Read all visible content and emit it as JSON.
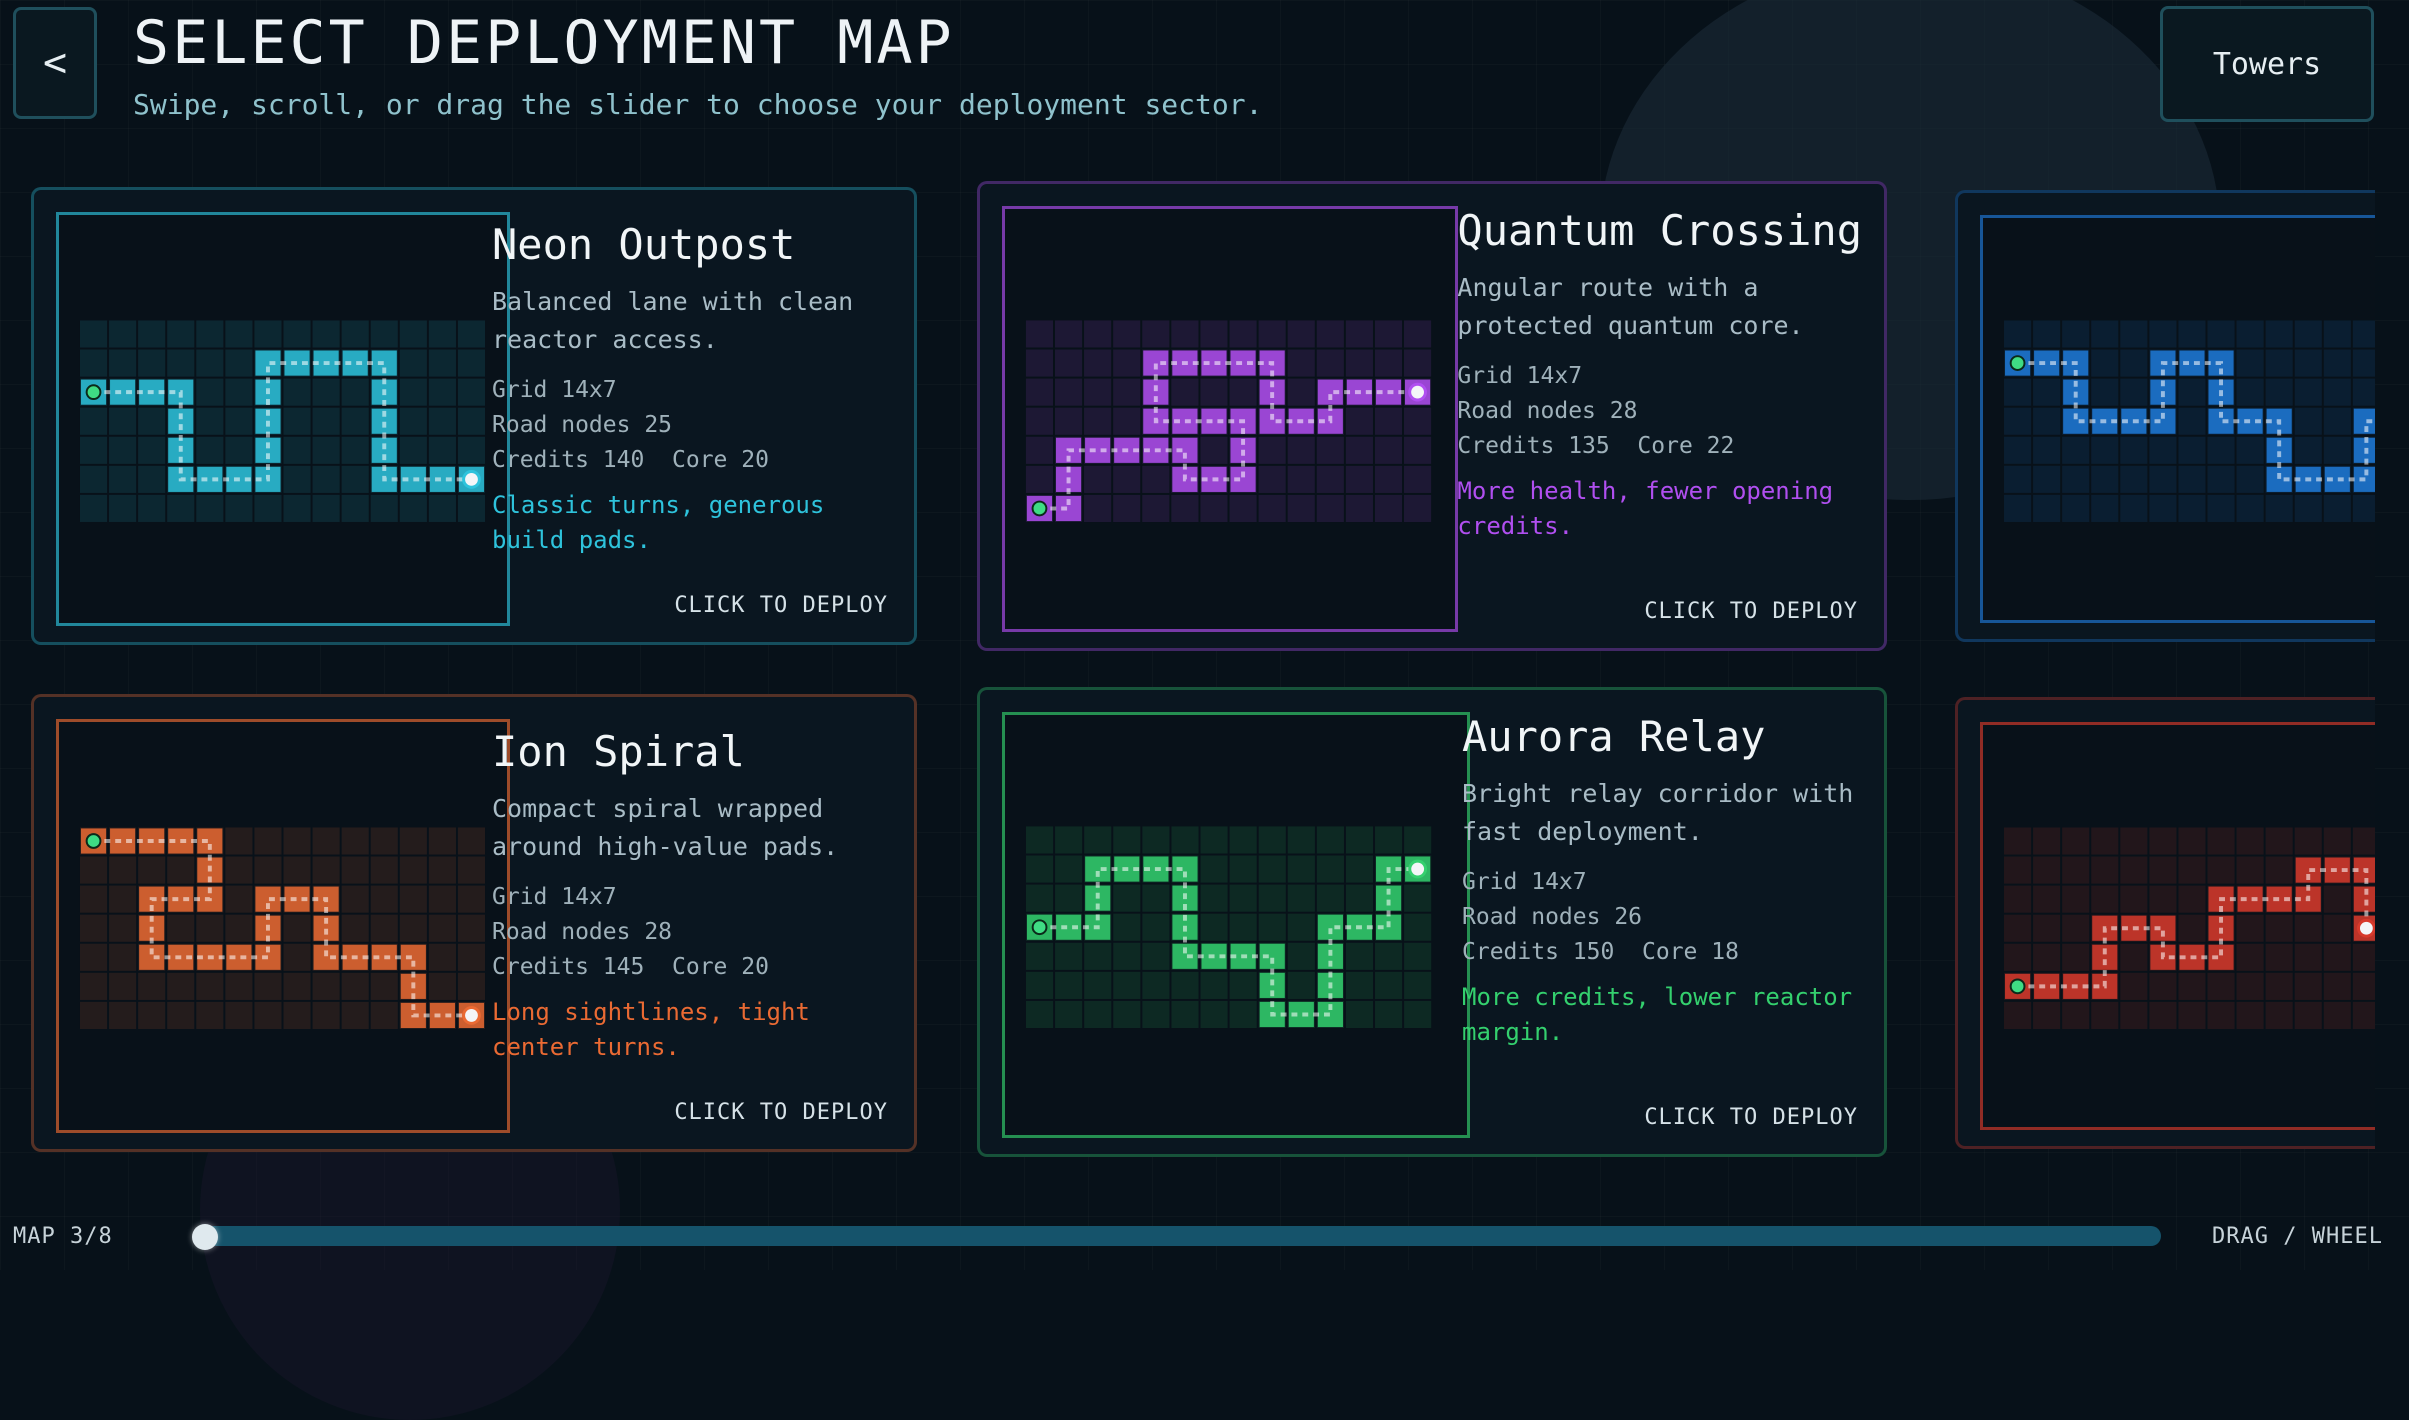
{
  "header": {
    "back_label": "<",
    "title": "SELECT DEPLOYMENT MAP",
    "subtitle": "Swipe, scroll, or drag the slider to choose your deployment sector.",
    "towers_label": "Towers"
  },
  "maps": [
    {
      "name": "Neon Outpost",
      "description": "Balanced lane with clean reactor access.",
      "grid": "Grid 14x7",
      "road_nodes": "Road nodes 25",
      "credits_core": "Credits 140  Core 20",
      "note": "Classic turns, generous build pads.",
      "deploy_label": "CLICK TO DEPLOY",
      "accent": "#2ec3dc",
      "path": [
        [
          0,
          2
        ],
        [
          1,
          2
        ],
        [
          2,
          2
        ],
        [
          3,
          2
        ],
        [
          3,
          3
        ],
        [
          3,
          4
        ],
        [
          3,
          5
        ],
        [
          4,
          5
        ],
        [
          5,
          5
        ],
        [
          6,
          5
        ],
        [
          6,
          4
        ],
        [
          6,
          3
        ],
        [
          6,
          2
        ],
        [
          6,
          1
        ],
        [
          7,
          1
        ],
        [
          8,
          1
        ],
        [
          9,
          1
        ],
        [
          10,
          1
        ],
        [
          10,
          2
        ],
        [
          10,
          3
        ],
        [
          10,
          4
        ],
        [
          10,
          5
        ],
        [
          11,
          5
        ],
        [
          12,
          5
        ],
        [
          13,
          5
        ]
      ]
    },
    {
      "name": "Quantum Crossing",
      "description": "Angular route with a protected quantum core.",
      "grid": "Grid 14x7",
      "road_nodes": "Road nodes 28",
      "credits_core": "Credits 135  Core 22",
      "note": "More health, fewer opening credits.",
      "deploy_label": "CLICK TO DEPLOY",
      "accent": "#b04ff0",
      "path": [
        [
          0,
          6
        ],
        [
          1,
          6
        ],
        [
          1,
          5
        ],
        [
          1,
          4
        ],
        [
          2,
          4
        ],
        [
          3,
          4
        ],
        [
          4,
          4
        ],
        [
          5,
          4
        ],
        [
          5,
          5
        ],
        [
          6,
          5
        ],
        [
          7,
          5
        ],
        [
          7,
          4
        ],
        [
          7,
          3
        ],
        [
          6,
          3
        ],
        [
          5,
          3
        ],
        [
          4,
          3
        ],
        [
          4,
          2
        ],
        [
          4,
          1
        ],
        [
          5,
          1
        ],
        [
          6,
          1
        ],
        [
          7,
          1
        ],
        [
          8,
          1
        ],
        [
          8,
          2
        ],
        [
          8,
          3
        ],
        [
          9,
          3
        ],
        [
          10,
          3
        ],
        [
          10,
          2
        ],
        [
          11,
          2
        ],
        [
          12,
          2
        ],
        [
          13,
          2
        ]
      ]
    },
    {
      "name": "Ion Spiral",
      "description": "Compact spiral wrapped around high-value pads.",
      "grid": "Grid 14x7",
      "road_nodes": "Road nodes 28",
      "credits_core": "Credits 145  Core 20",
      "note": "Long sightlines, tight center turns.",
      "deploy_label": "CLICK TO DEPLOY",
      "accent": "#ea6a33",
      "path": [
        [
          0,
          0
        ],
        [
          1,
          0
        ],
        [
          2,
          0
        ],
        [
          3,
          0
        ],
        [
          4,
          0
        ],
        [
          4,
          1
        ],
        [
          4,
          2
        ],
        [
          3,
          2
        ],
        [
          2,
          2
        ],
        [
          2,
          3
        ],
        [
          2,
          4
        ],
        [
          3,
          4
        ],
        [
          4,
          4
        ],
        [
          5,
          4
        ],
        [
          6,
          4
        ],
        [
          6,
          3
        ],
        [
          6,
          2
        ],
        [
          7,
          2
        ],
        [
          8,
          2
        ],
        [
          8,
          3
        ],
        [
          8,
          4
        ],
        [
          9,
          4
        ],
        [
          10,
          4
        ],
        [
          11,
          4
        ],
        [
          11,
          5
        ],
        [
          11,
          6
        ],
        [
          12,
          6
        ],
        [
          13,
          6
        ]
      ]
    },
    {
      "name": "Aurora Relay",
      "description": "Bright relay corridor with fast deployment.",
      "grid": "Grid 14x7",
      "road_nodes": "Road nodes 26",
      "credits_core": "Credits 150  Core 18",
      "note": "More credits, lower reactor margin.",
      "deploy_label": "CLICK TO DEPLOY",
      "accent": "#34d06e",
      "path": [
        [
          0,
          3
        ],
        [
          1,
          3
        ],
        [
          2,
          3
        ],
        [
          2,
          2
        ],
        [
          2,
          1
        ],
        [
          3,
          1
        ],
        [
          4,
          1
        ],
        [
          5,
          1
        ],
        [
          5,
          2
        ],
        [
          5,
          3
        ],
        [
          5,
          4
        ],
        [
          6,
          4
        ],
        [
          7,
          4
        ],
        [
          8,
          4
        ],
        [
          8,
          5
        ],
        [
          8,
          6
        ],
        [
          9,
          6
        ],
        [
          10,
          6
        ],
        [
          10,
          5
        ],
        [
          10,
          4
        ],
        [
          10,
          3
        ],
        [
          11,
          3
        ],
        [
          12,
          3
        ],
        [
          12,
          2
        ],
        [
          12,
          1
        ],
        [
          13,
          1
        ]
      ]
    },
    {
      "accent": "#1f7ad8",
      "path": [
        [
          0,
          1
        ],
        [
          1,
          1
        ],
        [
          2,
          1
        ],
        [
          2,
          2
        ],
        [
          2,
          3
        ],
        [
          3,
          3
        ],
        [
          4,
          3
        ],
        [
          5,
          3
        ],
        [
          5,
          2
        ],
        [
          5,
          1
        ],
        [
          6,
          1
        ],
        [
          7,
          1
        ],
        [
          7,
          2
        ],
        [
          7,
          3
        ],
        [
          8,
          3
        ],
        [
          9,
          3
        ],
        [
          9,
          4
        ],
        [
          9,
          5
        ],
        [
          10,
          5
        ],
        [
          11,
          5
        ],
        [
          12,
          5
        ],
        [
          12,
          4
        ],
        [
          12,
          3
        ],
        [
          13,
          3
        ]
      ]
    },
    {
      "accent": "#d73a2c",
      "path": [
        [
          0,
          5
        ],
        [
          1,
          5
        ],
        [
          2,
          5
        ],
        [
          3,
          5
        ],
        [
          3,
          4
        ],
        [
          3,
          3
        ],
        [
          4,
          3
        ],
        [
          5,
          3
        ],
        [
          5,
          4
        ],
        [
          6,
          4
        ],
        [
          7,
          4
        ],
        [
          7,
          3
        ],
        [
          7,
          2
        ],
        [
          8,
          2
        ],
        [
          9,
          2
        ],
        [
          10,
          2
        ],
        [
          10,
          1
        ],
        [
          11,
          1
        ],
        [
          12,
          1
        ],
        [
          12,
          2
        ],
        [
          12,
          3
        ]
      ]
    }
  ],
  "footer": {
    "map_index": "MAP 3/8",
    "hint": "DRAG / WHEEL",
    "slider_position": 0.0
  }
}
